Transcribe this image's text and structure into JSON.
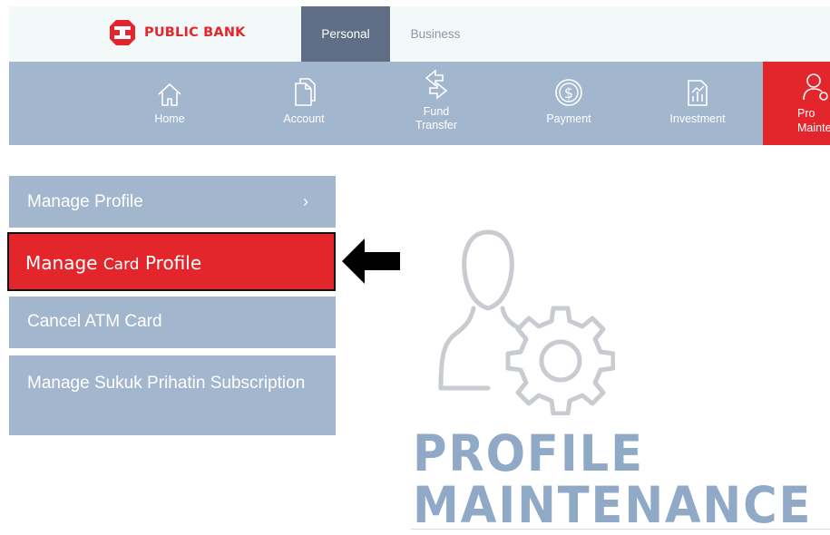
{
  "brand": {
    "name": "PUBLIC BANK",
    "color": "#e3262b"
  },
  "tabs": [
    {
      "label": "Personal",
      "active": true
    },
    {
      "label": "Business",
      "active": false
    }
  ],
  "nav": {
    "items": [
      {
        "label": "Home",
        "icon": "home-icon"
      },
      {
        "label": "Account",
        "icon": "document-icon"
      },
      {
        "label": "Fund\nTransfer",
        "icon": "transfer-arrows-icon"
      },
      {
        "label": "Payment",
        "icon": "dollar-coin-icon"
      },
      {
        "label": "Investment",
        "icon": "investment-chart-icon"
      }
    ],
    "active": {
      "label": "Pro\nMainte",
      "icon": "profile-settings-icon"
    }
  },
  "menu": {
    "manage_profile": "Manage Profile",
    "manage_card_profile": {
      "part1": "Manage ",
      "part2": "Card",
      "part3": " Profile"
    },
    "cancel_atm": "Cancel ATM Card",
    "manage_sukuk": "Manage Sukuk Prihatin Subscription"
  },
  "hero": {
    "line1": "PROFILE",
    "line2": "MAINTENANCE"
  },
  "colors": {
    "nav_bg": "#a2b6cd",
    "active_red": "#e3262b",
    "tab_active": "#5f6e84",
    "headline": "#8fa9c6"
  }
}
